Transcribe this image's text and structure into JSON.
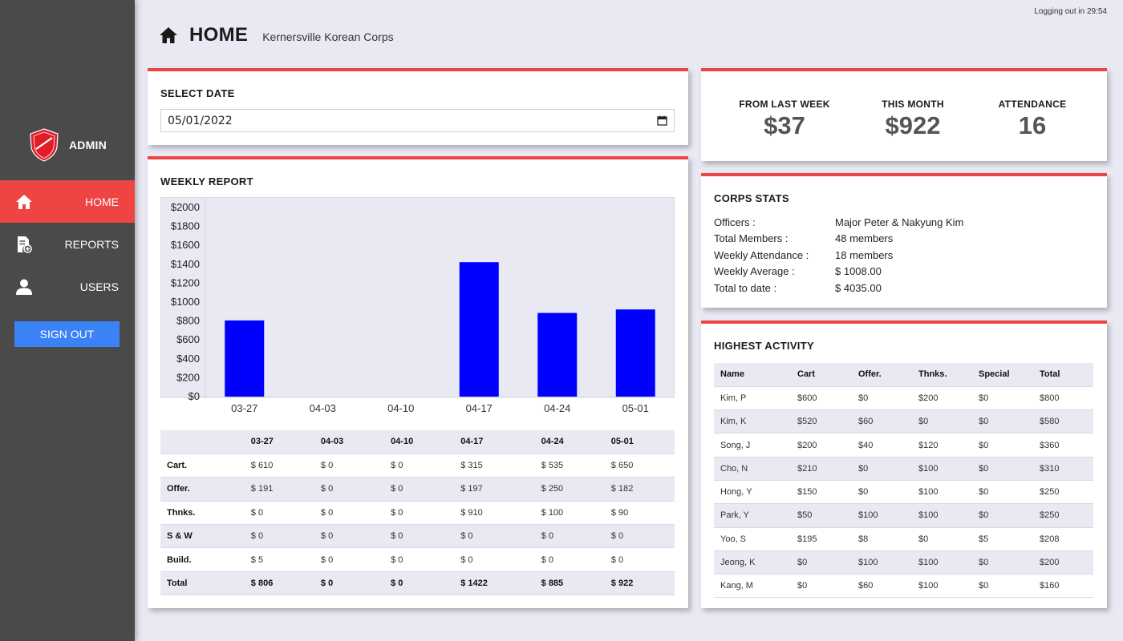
{
  "sidebar": {
    "role": "ADMIN",
    "nav": [
      {
        "label": "HOME",
        "icon": "home-icon",
        "active": true
      },
      {
        "label": "REPORTS",
        "icon": "report-add-icon",
        "active": false
      },
      {
        "label": "USERS",
        "icon": "user-icon",
        "active": false
      }
    ],
    "signout_label": "SIGN OUT"
  },
  "header": {
    "title": "HOME",
    "org": "Kernersville Korean Corps",
    "logout_timer": "Logging out in 29:54"
  },
  "select_date": {
    "title": "SELECT DATE",
    "value": "05/01/2022"
  },
  "weekly_report": {
    "title": "WEEKLY REPORT",
    "columns": [
      "",
      "03-27",
      "04-03",
      "04-10",
      "04-17",
      "04-24",
      "05-01"
    ],
    "rows": [
      {
        "label": "Cart.",
        "values": [
          "$ 610",
          "$ 0",
          "$ 0",
          "$ 315",
          "$ 535",
          "$ 650"
        ]
      },
      {
        "label": "Offer.",
        "values": [
          "$ 191",
          "$ 0",
          "$ 0",
          "$ 197",
          "$ 250",
          "$ 182"
        ]
      },
      {
        "label": "Thnks.",
        "values": [
          "$ 0",
          "$ 0",
          "$ 0",
          "$ 910",
          "$ 100",
          "$ 90"
        ]
      },
      {
        "label": "S & W",
        "values": [
          "$ 0",
          "$ 0",
          "$ 0",
          "$ 0",
          "$ 0",
          "$ 0"
        ]
      },
      {
        "label": "Build.",
        "values": [
          "$ 5",
          "$ 0",
          "$ 0",
          "$ 0",
          "$ 0",
          "$ 0"
        ]
      },
      {
        "label": "Total",
        "values": [
          "$ 806",
          "$ 0",
          "$ 0",
          "$ 1422",
          "$ 885",
          "$ 922"
        ]
      }
    ]
  },
  "chart_data": {
    "type": "bar",
    "categories": [
      "03-27",
      "04-03",
      "04-10",
      "04-17",
      "04-24",
      "05-01"
    ],
    "values": [
      806,
      0,
      0,
      1422,
      885,
      922
    ],
    "ylim": [
      0,
      2000
    ],
    "yticks": [
      "$0",
      "$200",
      "$400",
      "$600",
      "$800",
      "$1000",
      "$1200",
      "$1400",
      "$1600",
      "$1800",
      "$2000"
    ],
    "bar_color": "#0000ff",
    "title": "",
    "xlabel": "",
    "ylabel": ""
  },
  "summary": [
    {
      "label": "FROM LAST WEEK",
      "value": "$37"
    },
    {
      "label": "THIS MONTH",
      "value": "$922"
    },
    {
      "label": "ATTENDANCE",
      "value": "16"
    }
  ],
  "corps_stats": {
    "title": "CORPS STATS",
    "items": [
      {
        "key": "Officers :",
        "value": "Major Peter & Nakyung Kim"
      },
      {
        "key": "Total Members :",
        "value": "48 members"
      },
      {
        "key": "Weekly Attendance :",
        "value": "18 members"
      },
      {
        "key": "Weekly Average :",
        "value": "$ 1008.00"
      },
      {
        "key": "Total to date :",
        "value": "$ 4035.00"
      }
    ]
  },
  "highest_activity": {
    "title": "HIGHEST ACTIVITY",
    "columns": [
      "Name",
      "Cart",
      "Offer.",
      "Thnks.",
      "Special",
      "Total"
    ],
    "rows": [
      [
        "Kim, P",
        "$600",
        "$0",
        "$200",
        "$0",
        "$800"
      ],
      [
        "Kim, K",
        "$520",
        "$60",
        "$0",
        "$0",
        "$580"
      ],
      [
        "Song, J",
        "$200",
        "$40",
        "$120",
        "$0",
        "$360"
      ],
      [
        "Cho, N",
        "$210",
        "$0",
        "$100",
        "$0",
        "$310"
      ],
      [
        "Hong, Y",
        "$150",
        "$0",
        "$100",
        "$0",
        "$250"
      ],
      [
        "Park, Y",
        "$50",
        "$100",
        "$100",
        "$0",
        "$250"
      ],
      [
        "Yoo, S",
        "$195",
        "$8",
        "$0",
        "$5",
        "$208"
      ],
      [
        "Jeong, K",
        "$0",
        "$100",
        "$100",
        "$0",
        "$200"
      ],
      [
        "Kang, M",
        "$0",
        "$60",
        "$100",
        "$0",
        "$160"
      ]
    ]
  },
  "colors": {
    "accent": "#ef4444",
    "sidebar": "#4a4a4a",
    "button": "#3b82f6",
    "bar": "#0000ff"
  }
}
